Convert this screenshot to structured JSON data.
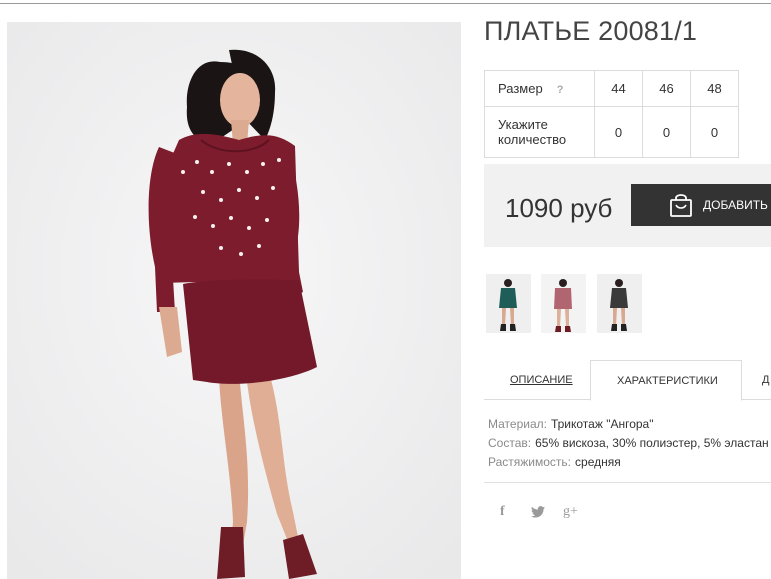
{
  "product": {
    "title": "ПЛАТЬЕ 20081/1"
  },
  "size_table": {
    "size_label": "Размер",
    "help_icon": "?",
    "sizes": [
      "44",
      "46",
      "48"
    ],
    "qty_label": "Укажите количество",
    "quantities": [
      "0",
      "0",
      "0"
    ]
  },
  "purchase": {
    "price": "1090 руб",
    "add_label": "ДОБАВИТЬ В",
    "add_icon": "shopping-bag-icon"
  },
  "thumbnails": [
    {
      "name": "thumbnail-green",
      "color": "#1f5e58"
    },
    {
      "name": "thumbnail-burgundy",
      "color": "#7d1c2c"
    },
    {
      "name": "thumbnail-dark-grey",
      "color": "#3a3a3a"
    }
  ],
  "tabs": [
    {
      "label": "ОПИСАНИЕ",
      "active": false
    },
    {
      "label": "ХАРАКТЕРИСТИКИ",
      "active": true
    },
    {
      "label": "Д",
      "active": false
    }
  ],
  "characteristics": [
    {
      "key": "Материал:",
      "value": "Трикотаж \"Ангора\""
    },
    {
      "key": "Состав:",
      "value": "65% вискоза, 30% полиэстер, 5% эластан"
    },
    {
      "key": "Растяжимость:",
      "value": "средняя"
    }
  ],
  "social": {
    "facebook": "f",
    "twitter": "twitter-icon",
    "google_plus": "g+"
  },
  "colors": {
    "dress": "#7d1c2c",
    "button_bg": "#333333",
    "price_bar_bg": "#f1f1f1",
    "photo_bg": "#f1f1f2"
  }
}
